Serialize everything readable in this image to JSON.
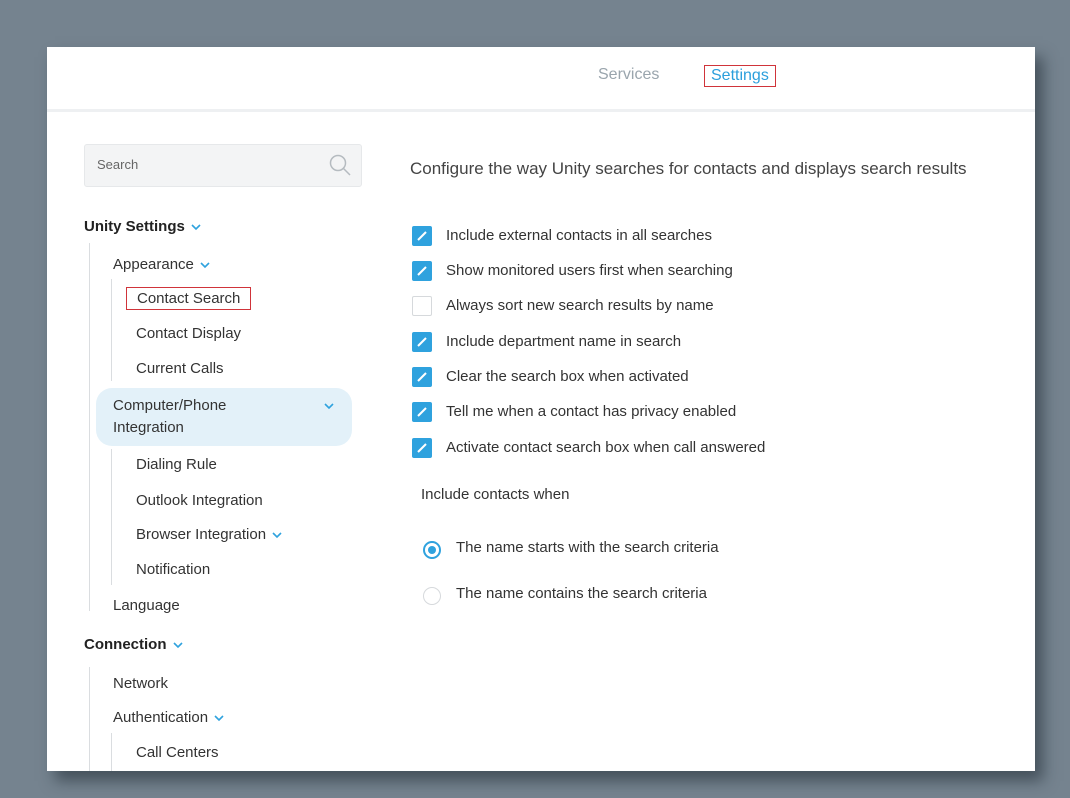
{
  "header": {
    "tabs": [
      {
        "label": "Services"
      },
      {
        "label": "Settings"
      }
    ]
  },
  "sidebar": {
    "search_placeholder": "Search",
    "unity_settings": "Unity Settings",
    "appearance": "Appearance",
    "contact_search": "Contact Search",
    "contact_display": "Contact Display",
    "current_calls": "Current Calls",
    "cpi_line1": "Computer/Phone",
    "cpi_line2": "Integration",
    "dialing_rule": "Dialing Rule",
    "outlook_integration": "Outlook Integration",
    "browser_integration": "Browser Integration",
    "notification": "Notification",
    "language": "Language",
    "connection": "Connection",
    "network": "Network",
    "authentication": "Authentication",
    "call_centers": "Call Centers"
  },
  "main": {
    "heading": "Configure the way Unity searches for contacts and displays search results",
    "options": [
      {
        "label": "Include external contacts in all searches",
        "checked": true
      },
      {
        "label": "Show monitored users first when searching",
        "checked": true
      },
      {
        "label": "Always sort new search results by name",
        "checked": false
      },
      {
        "label": "Include department name in search",
        "checked": true
      },
      {
        "label": "Clear the search box when activated",
        "checked": true
      },
      {
        "label": "Tell me when a contact has privacy enabled",
        "checked": true
      },
      {
        "label": "Activate contact search box when call answered",
        "checked": true
      }
    ],
    "include_contacts_label": "Include contacts when",
    "radios": [
      {
        "label": "The name starts with the search criteria",
        "selected": true
      },
      {
        "label": "The name contains the search criteria",
        "selected": false
      }
    ]
  },
  "colors": {
    "accent": "#2fa2de",
    "highlight_border": "#d0343a",
    "backdrop": "#75838f"
  }
}
